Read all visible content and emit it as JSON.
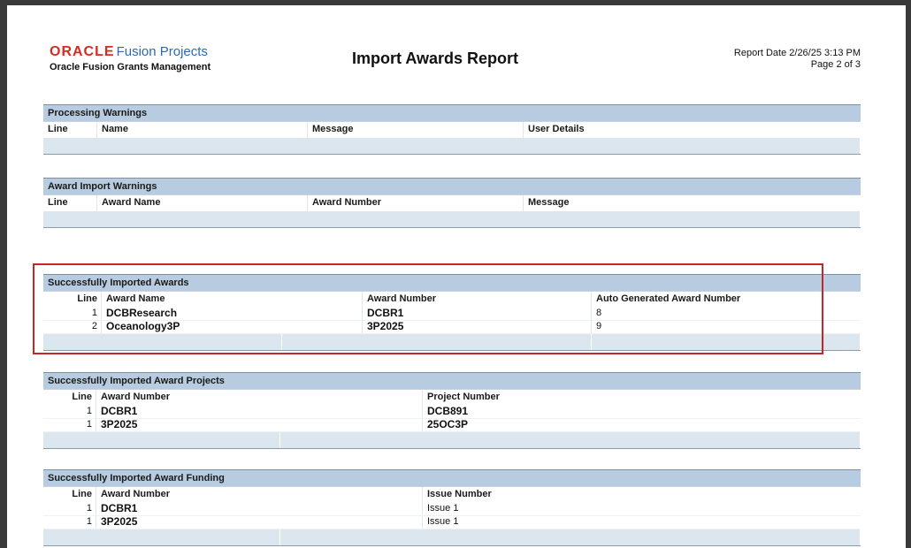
{
  "header": {
    "brand_oracle": "ORACLE",
    "brand_product": "Fusion Projects",
    "brand_sub": "Oracle Fusion Grants Management",
    "title": "Import Awards Report",
    "report_date": "Report Date 2/26/25 3:13 PM",
    "page_info": "Page 2 of 3"
  },
  "processing_warnings": {
    "title": "Processing Warnings",
    "columns": [
      "Line",
      "Name",
      "Message",
      "User Details"
    ]
  },
  "award_import_warnings": {
    "title": "Award Import Warnings",
    "columns": [
      "Line",
      "Award Name",
      "Award Number",
      "Message"
    ]
  },
  "imported_awards": {
    "title": "Successfully Imported Awards",
    "columns": [
      "Line",
      "Award Name",
      "Award Number",
      "Auto Generated Award Number"
    ],
    "rows": [
      {
        "line": "1",
        "name": "DCBResearch",
        "number": "DCBR1",
        "auto": "8"
      },
      {
        "line": "2",
        "name": "Oceanology3P",
        "number": "3P2025",
        "auto": "9"
      }
    ]
  },
  "award_projects": {
    "title": "Successfully Imported Award Projects",
    "columns": [
      "Line",
      "Award Number",
      "Project Number"
    ],
    "rows": [
      {
        "line": "1",
        "number": "DCBR1",
        "project": "DCB891"
      },
      {
        "line": "1",
        "number": "3P2025",
        "project": "25OC3P"
      }
    ]
  },
  "award_funding": {
    "title": "Successfully Imported Award Funding",
    "columns": [
      "Line",
      "Award Number",
      "Issue Number"
    ],
    "rows": [
      {
        "line": "1",
        "number": "DCBR1",
        "issue": "Issue 1"
      },
      {
        "line": "1",
        "number": "3P2025",
        "issue": "Issue 1"
      }
    ]
  },
  "colors": {
    "highlight_border": "#c0282a",
    "section_title_bg": "#b7cce0",
    "footer_bg": "#dce6ef",
    "oracle_red": "#d62b20",
    "fusion_blue": "#2f69b0"
  }
}
